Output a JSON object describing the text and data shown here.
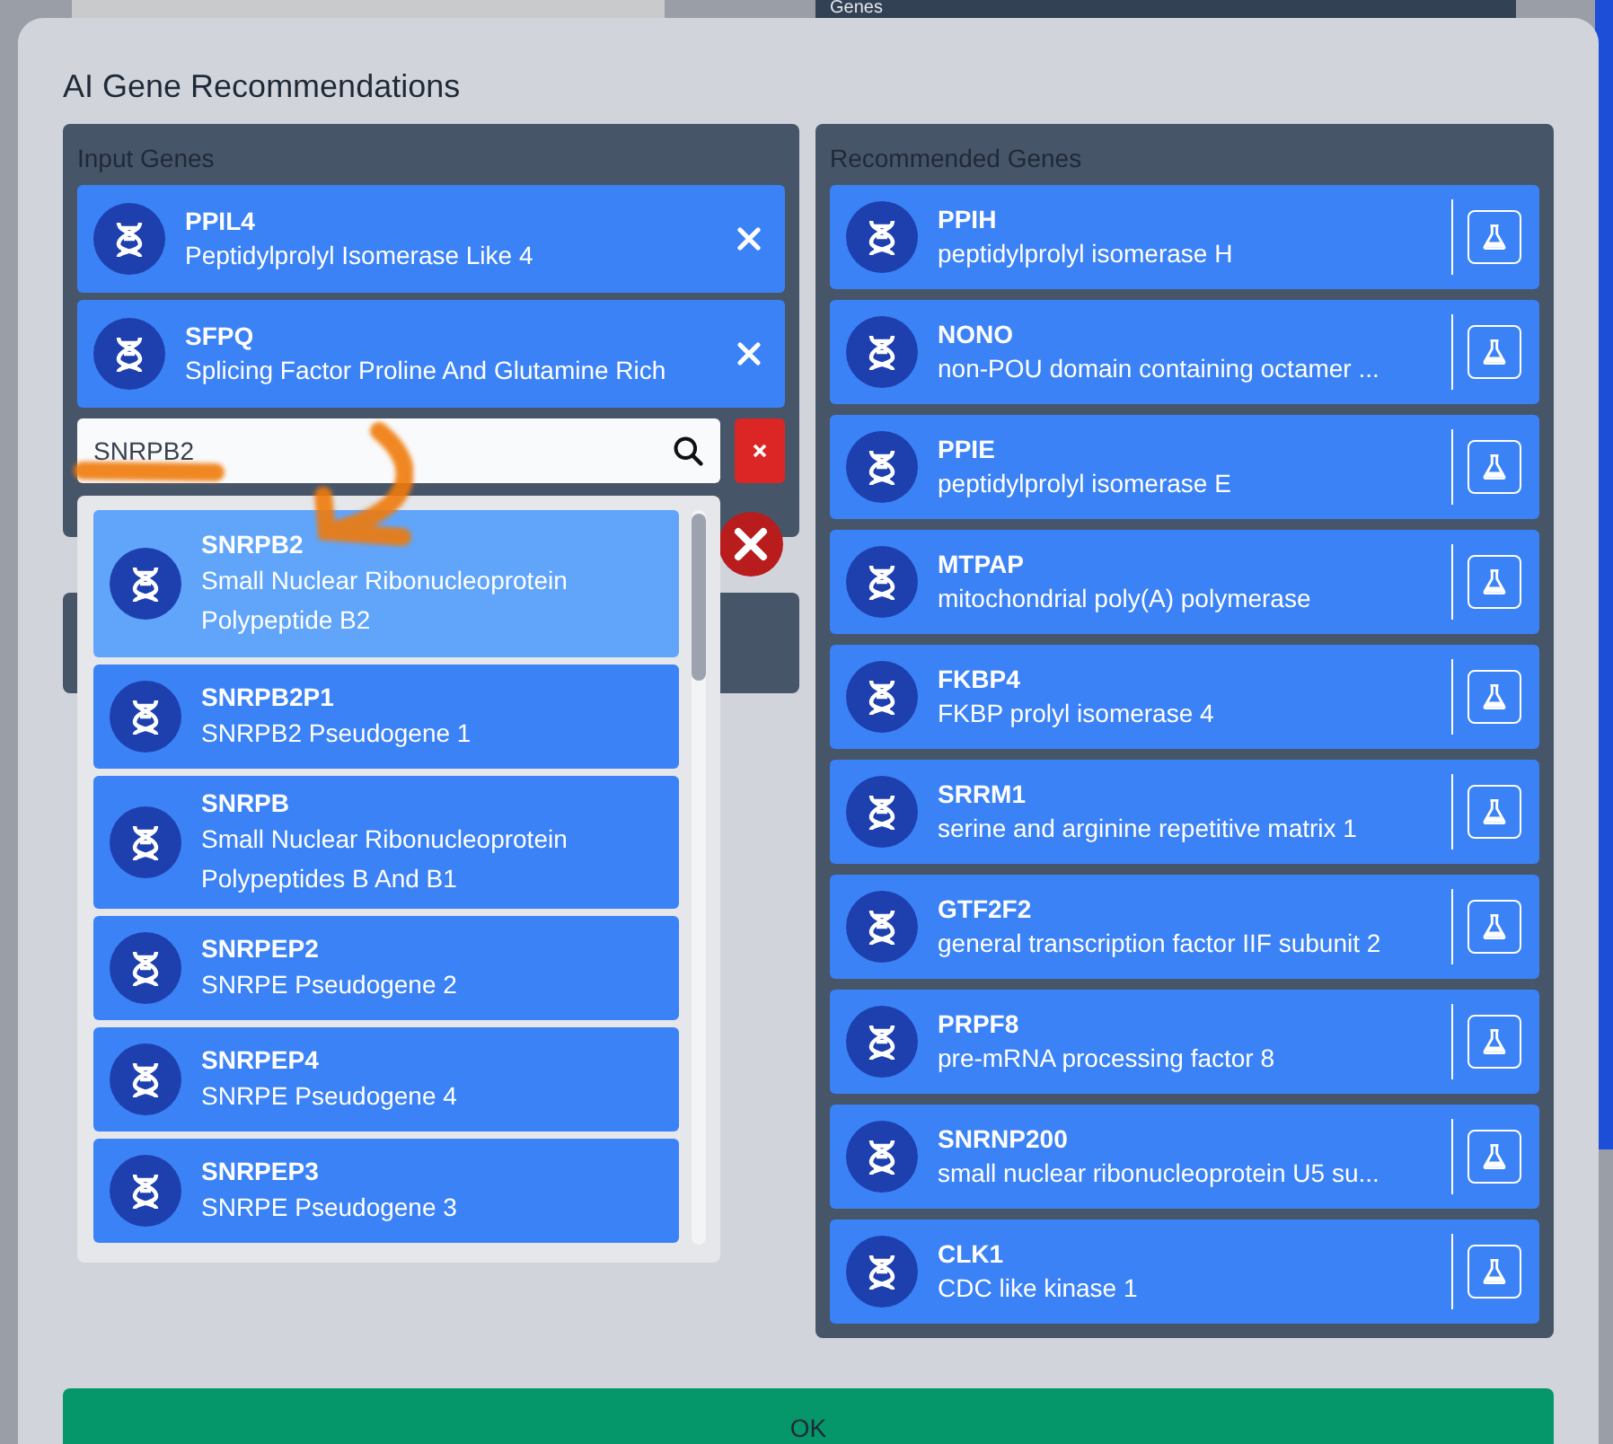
{
  "background": {
    "panel_title": "Genes"
  },
  "dialog": {
    "title": "AI Gene Recommendations"
  },
  "input_genes": {
    "title": "Input Genes",
    "genes": [
      {
        "symbol": "PPIL4",
        "name": "Peptidylprolyl Isomerase Like 4"
      },
      {
        "symbol": "SFPQ",
        "name": "Splicing Factor Proline And Glutamine Rich"
      }
    ],
    "search": {
      "value": "SNRPB2"
    },
    "suggestions": [
      {
        "symbol": "SNRPB2",
        "name": "Small Nuclear Ribonucleoprotein Polypeptide B2",
        "selected": true
      },
      {
        "symbol": "SNRPB2P1",
        "name": "SNRPB2 Pseudogene 1",
        "selected": false
      },
      {
        "symbol": "SNRPB",
        "name": "Small Nuclear Ribonucleoprotein Polypeptides B And B1",
        "selected": false
      },
      {
        "symbol": "SNRPEP2",
        "name": "SNRPE Pseudogene 2",
        "selected": false
      },
      {
        "symbol": "SNRPEP4",
        "name": "SNRPE Pseudogene 4",
        "selected": false
      },
      {
        "symbol": "SNRPEP3",
        "name": "SNRPE Pseudogene 3",
        "selected": false
      }
    ]
  },
  "recommended_genes": {
    "title": "Recommended Genes",
    "genes": [
      {
        "symbol": "PPIH",
        "name": "peptidylprolyl isomerase H"
      },
      {
        "symbol": "NONO",
        "name": "non-POU domain containing octamer ..."
      },
      {
        "symbol": "PPIE",
        "name": "peptidylprolyl isomerase E"
      },
      {
        "symbol": "MTPAP",
        "name": "mitochondrial poly(A) polymerase"
      },
      {
        "symbol": "FKBP4",
        "name": "FKBP prolyl isomerase 4"
      },
      {
        "symbol": "SRRM1",
        "name": "serine and arginine repetitive matrix 1"
      },
      {
        "symbol": "GTF2F2",
        "name": "general transcription factor IIF subunit 2"
      },
      {
        "symbol": "PRPF8",
        "name": "pre-mRNA processing factor 8"
      },
      {
        "symbol": "SNRNP200",
        "name": "small nuclear ribonucleoprotein U5 su..."
      },
      {
        "symbol": "CLK1",
        "name": "CDC like kinase 1"
      }
    ]
  },
  "ok_button": "OK"
}
